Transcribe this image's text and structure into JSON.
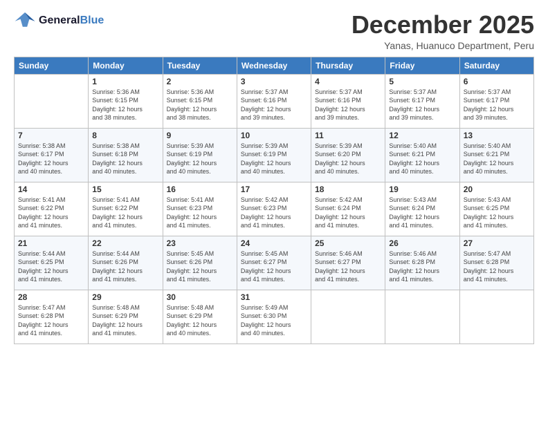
{
  "logo": {
    "line1": "General",
    "line2": "Blue"
  },
  "title": "December 2025",
  "location": "Yanas, Huanuco Department, Peru",
  "weekdays": [
    "Sunday",
    "Monday",
    "Tuesday",
    "Wednesday",
    "Thursday",
    "Friday",
    "Saturday"
  ],
  "weeks": [
    [
      {
        "day": "",
        "sunrise": "",
        "sunset": "",
        "daylight": ""
      },
      {
        "day": "1",
        "sunrise": "5:36 AM",
        "sunset": "6:15 PM",
        "daylight": "12 hours and 38 minutes."
      },
      {
        "day": "2",
        "sunrise": "5:36 AM",
        "sunset": "6:15 PM",
        "daylight": "12 hours and 38 minutes."
      },
      {
        "day": "3",
        "sunrise": "5:37 AM",
        "sunset": "6:16 PM",
        "daylight": "12 hours and 39 minutes."
      },
      {
        "day": "4",
        "sunrise": "5:37 AM",
        "sunset": "6:16 PM",
        "daylight": "12 hours and 39 minutes."
      },
      {
        "day": "5",
        "sunrise": "5:37 AM",
        "sunset": "6:17 PM",
        "daylight": "12 hours and 39 minutes."
      },
      {
        "day": "6",
        "sunrise": "5:37 AM",
        "sunset": "6:17 PM",
        "daylight": "12 hours and 39 minutes."
      }
    ],
    [
      {
        "day": "7",
        "sunrise": "5:38 AM",
        "sunset": "6:17 PM",
        "daylight": "12 hours and 40 minutes."
      },
      {
        "day": "8",
        "sunrise": "5:38 AM",
        "sunset": "6:18 PM",
        "daylight": "12 hours and 40 minutes."
      },
      {
        "day": "9",
        "sunrise": "5:39 AM",
        "sunset": "6:19 PM",
        "daylight": "12 hours and 40 minutes."
      },
      {
        "day": "10",
        "sunrise": "5:39 AM",
        "sunset": "6:19 PM",
        "daylight": "12 hours and 40 minutes."
      },
      {
        "day": "11",
        "sunrise": "5:39 AM",
        "sunset": "6:20 PM",
        "daylight": "12 hours and 40 minutes."
      },
      {
        "day": "12",
        "sunrise": "5:40 AM",
        "sunset": "6:21 PM",
        "daylight": "12 hours and 40 minutes."
      },
      {
        "day": "13",
        "sunrise": "5:40 AM",
        "sunset": "6:21 PM",
        "daylight": "12 hours and 40 minutes."
      }
    ],
    [
      {
        "day": "14",
        "sunrise": "5:41 AM",
        "sunset": "6:22 PM",
        "daylight": "12 hours and 41 minutes."
      },
      {
        "day": "15",
        "sunrise": "5:41 AM",
        "sunset": "6:22 PM",
        "daylight": "12 hours and 41 minutes."
      },
      {
        "day": "16",
        "sunrise": "5:41 AM",
        "sunset": "6:23 PM",
        "daylight": "12 hours and 41 minutes."
      },
      {
        "day": "17",
        "sunrise": "5:42 AM",
        "sunset": "6:23 PM",
        "daylight": "12 hours and 41 minutes."
      },
      {
        "day": "18",
        "sunrise": "5:42 AM",
        "sunset": "6:24 PM",
        "daylight": "12 hours and 41 minutes."
      },
      {
        "day": "19",
        "sunrise": "5:43 AM",
        "sunset": "6:24 PM",
        "daylight": "12 hours and 41 minutes."
      },
      {
        "day": "20",
        "sunrise": "5:43 AM",
        "sunset": "6:25 PM",
        "daylight": "12 hours and 41 minutes."
      }
    ],
    [
      {
        "day": "21",
        "sunrise": "5:44 AM",
        "sunset": "6:25 PM",
        "daylight": "12 hours and 41 minutes."
      },
      {
        "day": "22",
        "sunrise": "5:44 AM",
        "sunset": "6:26 PM",
        "daylight": "12 hours and 41 minutes."
      },
      {
        "day": "23",
        "sunrise": "5:45 AM",
        "sunset": "6:26 PM",
        "daylight": "12 hours and 41 minutes."
      },
      {
        "day": "24",
        "sunrise": "5:45 AM",
        "sunset": "6:27 PM",
        "daylight": "12 hours and 41 minutes."
      },
      {
        "day": "25",
        "sunrise": "5:46 AM",
        "sunset": "6:27 PM",
        "daylight": "12 hours and 41 minutes."
      },
      {
        "day": "26",
        "sunrise": "5:46 AM",
        "sunset": "6:28 PM",
        "daylight": "12 hours and 41 minutes."
      },
      {
        "day": "27",
        "sunrise": "5:47 AM",
        "sunset": "6:28 PM",
        "daylight": "12 hours and 41 minutes."
      }
    ],
    [
      {
        "day": "28",
        "sunrise": "5:47 AM",
        "sunset": "6:28 PM",
        "daylight": "12 hours and 41 minutes."
      },
      {
        "day": "29",
        "sunrise": "5:48 AM",
        "sunset": "6:29 PM",
        "daylight": "12 hours and 41 minutes."
      },
      {
        "day": "30",
        "sunrise": "5:48 AM",
        "sunset": "6:29 PM",
        "daylight": "12 hours and 40 minutes."
      },
      {
        "day": "31",
        "sunrise": "5:49 AM",
        "sunset": "6:30 PM",
        "daylight": "12 hours and 40 minutes."
      },
      {
        "day": "",
        "sunrise": "",
        "sunset": "",
        "daylight": ""
      },
      {
        "day": "",
        "sunrise": "",
        "sunset": "",
        "daylight": ""
      },
      {
        "day": "",
        "sunrise": "",
        "sunset": "",
        "daylight": ""
      }
    ]
  ],
  "labels": {
    "sunrise": "Sunrise:",
    "sunset": "Sunset:",
    "daylight": "Daylight: 12 hours"
  }
}
